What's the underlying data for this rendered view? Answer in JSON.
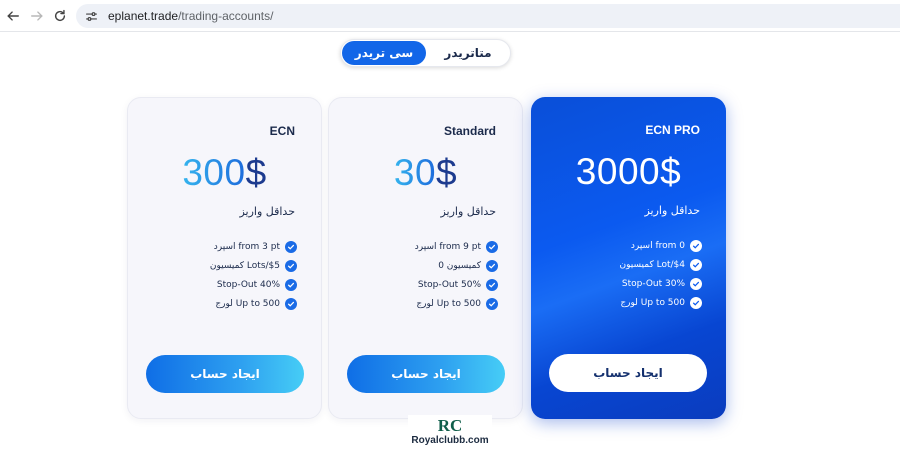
{
  "browser": {
    "url_host": "eplanet.trade",
    "url_path": "/trading-accounts/"
  },
  "toggle": {
    "active_label": "سی تریدر",
    "inactive_label": "متاتریدر"
  },
  "cards": [
    {
      "name": "ECN",
      "price_number": "300",
      "price_currency": "$",
      "deposit_label": "حداقل واریز",
      "features": [
        "اسپرد from 3 pt",
        "کمیسیون Lots/$5",
        "Stop-Out 40%",
        "لورج Up to 500"
      ],
      "button_label": "ایجاد حساب"
    },
    {
      "name": "Standard",
      "price_number": "30",
      "price_currency": "$",
      "deposit_label": "حداقل واریز",
      "features": [
        "اسپرد from 9 pt",
        "کمیسیون 0",
        "Stop-Out 50%",
        "لورج Up to 500"
      ],
      "button_label": "ایجاد حساب"
    },
    {
      "name": "ECN PRO",
      "price_number": "3000",
      "price_currency": "$",
      "deposit_label": "حداقل واریز",
      "features": [
        "اسپرد from 0",
        "کمیسیون Lot/$4",
        "Stop-Out 30%",
        "لورج Up to 500"
      ],
      "button_label": "ایجاد حساب"
    }
  ],
  "watermark": {
    "logo_text": "RC",
    "text": "Royalclubb.com"
  },
  "colors": {
    "primary": "#1266e8",
    "pro_card": "#0b5af0",
    "text_dark": "#1b2a4b"
  },
  "icons": {
    "back": "arrow-left-icon",
    "forward": "arrow-right-icon",
    "reload": "reload-icon",
    "site_settings": "tune-icon",
    "feature_check": "check-circle-icon"
  }
}
